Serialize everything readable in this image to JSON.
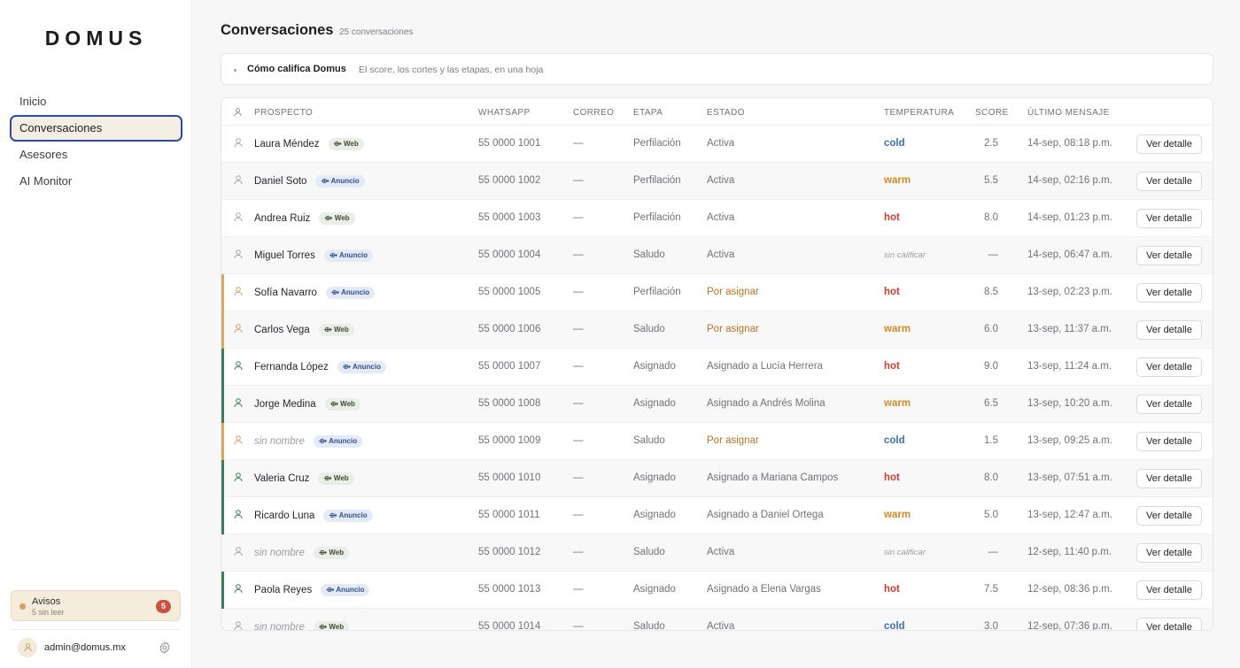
{
  "app": {
    "logo": "DOMUS",
    "nav": [
      {
        "label": "Inicio",
        "active": false
      },
      {
        "label": "Conversaciones",
        "active": true
      },
      {
        "label": "Asesores",
        "active": false
      },
      {
        "label": "AI Monitor",
        "active": false
      }
    ],
    "avisos": {
      "title": "Avisos",
      "subtitle": "5 sin leer",
      "count": "5"
    },
    "user": {
      "email": "admin@domus.mx"
    }
  },
  "page": {
    "title": "Conversaciones",
    "count": "25 conversaciones",
    "info": {
      "title": "Cómo califica Domus",
      "subtitle": "El score, los cortes y las etapas, en una hoja"
    }
  },
  "table": {
    "headers": {
      "prospecto": "PROSPECTO",
      "whatsapp": "WHATSAPP",
      "correo": "CORREO",
      "etapa": "ETAPA",
      "estado": "ESTADO",
      "temperatura": "TEMPERATURA",
      "score": "SCORE",
      "ultimo": "ÚLTIMO MENSAJE"
    },
    "action_label": "Ver detalle",
    "rows": [
      {
        "name": "Laura Méndez",
        "source": "Web",
        "whatsapp": "55 0000 1001",
        "correo": "—",
        "etapa": "Perfilación",
        "estado": "Activa",
        "temperatura": "cold",
        "score": "2.5",
        "ultimo": "14-sep, 08:18 p.m.",
        "status": "none"
      },
      {
        "name": "Daniel Soto",
        "source": "Anuncio",
        "whatsapp": "55 0000 1002",
        "correo": "—",
        "etapa": "Perfilación",
        "estado": "Activa",
        "temperatura": "warm",
        "score": "5.5",
        "ultimo": "14-sep, 02:16 p.m.",
        "status": "none"
      },
      {
        "name": "Andrea Ruiz",
        "source": "Web",
        "whatsapp": "55 0000 1003",
        "correo": "—",
        "etapa": "Perfilación",
        "estado": "Activa",
        "temperatura": "hot",
        "score": "8.0",
        "ultimo": "14-sep, 01:23 p.m.",
        "status": "none"
      },
      {
        "name": "Miguel Torres",
        "source": "Anuncio",
        "whatsapp": "55 0000 1004",
        "correo": "—",
        "etapa": "Saludo",
        "estado": "Activa",
        "temperatura": "sin calificar",
        "score": "—",
        "ultimo": "14-sep, 06:47 a.m.",
        "status": "none"
      },
      {
        "name": "Sofía Navarro",
        "source": "Anuncio",
        "whatsapp": "55 0000 1005",
        "correo": "—",
        "etapa": "Perfilación",
        "estado": "Por asignar",
        "temperatura": "hot",
        "score": "8.5",
        "ultimo": "13-sep, 02:23 p.m.",
        "status": "pending"
      },
      {
        "name": "Carlos Vega",
        "source": "Web",
        "whatsapp": "55 0000 1006",
        "correo": "—",
        "etapa": "Saludo",
        "estado": "Por asignar",
        "temperatura": "warm",
        "score": "6.0",
        "ultimo": "13-sep, 11:37 a.m.",
        "status": "pending"
      },
      {
        "name": "Fernanda López",
        "source": "Anuncio",
        "whatsapp": "55 0000 1007",
        "correo": "—",
        "etapa": "Asignado",
        "estado": "Asignado a Lucía Herrera",
        "temperatura": "hot",
        "score": "9.0",
        "ultimo": "13-sep, 11:24 a.m.",
        "status": "assigned"
      },
      {
        "name": "Jorge Medina",
        "source": "Web",
        "whatsapp": "55 0000 1008",
        "correo": "—",
        "etapa": "Asignado",
        "estado": "Asignado a Andrés Molina",
        "temperatura": "warm",
        "score": "6.5",
        "ultimo": "13-sep, 10:20 a.m.",
        "status": "assigned"
      },
      {
        "name": "sin nombre",
        "source": "Anuncio",
        "whatsapp": "55 0000 1009",
        "correo": "—",
        "etapa": "Saludo",
        "estado": "Por asignar",
        "temperatura": "cold",
        "score": "1.5",
        "ultimo": "13-sep, 09:25 a.m.",
        "status": "pending"
      },
      {
        "name": "Valeria Cruz",
        "source": "Web",
        "whatsapp": "55 0000 1010",
        "correo": "—",
        "etapa": "Asignado",
        "estado": "Asignado a Mariana Campos",
        "temperatura": "hot",
        "score": "8.0",
        "ultimo": "13-sep, 07:51 a.m.",
        "status": "assigned"
      },
      {
        "name": "Ricardo Luna",
        "source": "Anuncio",
        "whatsapp": "55 0000 1011",
        "correo": "—",
        "etapa": "Asignado",
        "estado": "Asignado a Daniel Ortega",
        "temperatura": "warm",
        "score": "5.0",
        "ultimo": "13-sep, 12:47 a.m.",
        "status": "assigned"
      },
      {
        "name": "sin nombre",
        "source": "Web",
        "whatsapp": "55 0000 1012",
        "correo": "—",
        "etapa": "Saludo",
        "estado": "Activa",
        "temperatura": "sin calificar",
        "score": "—",
        "ultimo": "12-sep, 11:40 p.m.",
        "status": "none"
      },
      {
        "name": "Paola Reyes",
        "source": "Anuncio",
        "whatsapp": "55 0000 1013",
        "correo": "—",
        "etapa": "Asignado",
        "estado": "Asignado a Elena Vargas",
        "temperatura": "hot",
        "score": "7.5",
        "ultimo": "12-sep, 08:36 p.m.",
        "status": "assigned"
      },
      {
        "name": "sin nombre",
        "source": "Web",
        "whatsapp": "55 0000 1014",
        "correo": "—",
        "etapa": "Saludo",
        "estado": "Activa",
        "temperatura": "cold",
        "score": "3.0",
        "ultimo": "12-sep, 07:36 p.m.",
        "status": "none"
      }
    ]
  },
  "colors": {
    "accent_pending": "#d8a866",
    "accent_assigned": "#3f7d5a",
    "icon_pending": "#d2a267",
    "icon_assigned": "#3f7d5a",
    "icon_default": "#a5a8ad"
  }
}
